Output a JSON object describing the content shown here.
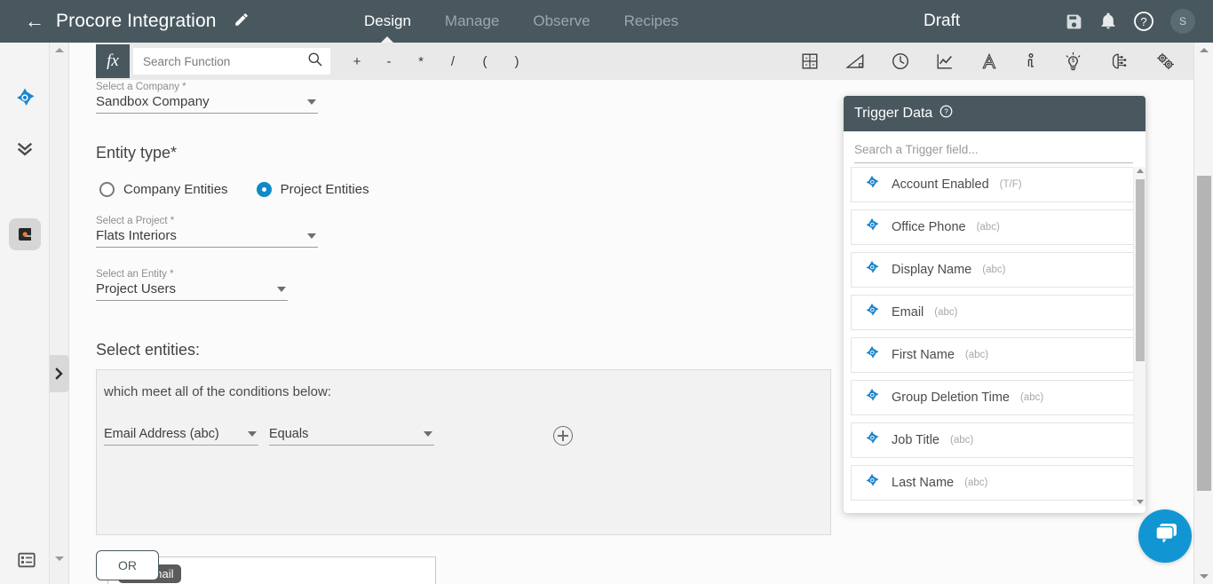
{
  "header": {
    "back_label": "back-arrow",
    "recipe_title": "Procore Integration",
    "edit_icon": "pencil-icon",
    "tabs": [
      {
        "label": "Design",
        "active": true
      },
      {
        "label": "Manage",
        "active": false
      },
      {
        "label": "Observe",
        "active": false
      },
      {
        "label": "Recipes",
        "active": false
      }
    ],
    "status": "Draft",
    "icons": [
      "save-icon",
      "notifications-bell-icon",
      "help-question-icon"
    ],
    "avatar_initial": "S"
  },
  "left_rail": {
    "items": [
      {
        "name": "azure-ad-trigger-icon"
      },
      {
        "name": "collapse-steps-icon"
      },
      {
        "name": "procore-step-icon"
      },
      {
        "name": "job-list-icon"
      }
    ],
    "expand_tab": "expand-panel-chevron-icon"
  },
  "formula_bar": {
    "fx_label": "fx",
    "search_placeholder": "Search Function",
    "search_value": "",
    "search_icon": "search-icon",
    "operators": [
      "+",
      "-",
      "*",
      "/",
      "(",
      ")"
    ],
    "tools": [
      "calculator-icon",
      "trigonometry-icon",
      "clock-icon",
      "chart-line-icon",
      "text-format-icon",
      "info-icon",
      "lightbulb-dollar-icon",
      "ai-brain-icon",
      "gears-icon"
    ]
  },
  "form": {
    "company": {
      "label": "Select a Company *",
      "value": "Sandbox Company"
    },
    "entity_type": {
      "title": "Entity type*",
      "options": [
        {
          "label": "Company Entities",
          "selected": false
        },
        {
          "label": "Project Entities",
          "selected": true
        }
      ]
    },
    "project": {
      "label": "Select a Project *",
      "value": "Flats Interiors"
    },
    "entity": {
      "label": "Select an Entity *",
      "value": "Project Users"
    },
    "select_entities_title": "Select entities:",
    "conditions": {
      "header": "which meet all of the conditions below:",
      "field": "Email Address (abc)",
      "operator": "Equals",
      "add_icon": "add-condition-icon",
      "value_pill": {
        "icon": "azure-ad-datapill-icon",
        "text": "Email"
      }
    },
    "or_button": "OR"
  },
  "trigger_panel": {
    "title": "Trigger Data",
    "help_icon": "help-question-icon",
    "search_placeholder": "Search a Trigger field...",
    "search_value": "",
    "fields": [
      {
        "name": "Account Enabled",
        "type": "(T/F)"
      },
      {
        "name": "Office Phone",
        "type": "(abc)"
      },
      {
        "name": "Display Name",
        "type": "(abc)"
      },
      {
        "name": "Email",
        "type": "(abc)"
      },
      {
        "name": "First Name",
        "type": "(abc)"
      },
      {
        "name": "Group Deletion Time",
        "type": "(abc)"
      },
      {
        "name": "Job Title",
        "type": "(abc)"
      },
      {
        "name": "Last Name",
        "type": "(abc)"
      }
    ]
  },
  "chat": {
    "icon": "chat-bubbles-icon"
  },
  "colors": {
    "header_bg": "#49585f",
    "accent_blue": "#0c8ac9",
    "datapill_blue": "#1b86cd",
    "chat_blue": "#1296d3",
    "procore_orange": "#f47b32",
    "canvas_bg": "#fbfbfb",
    "panel_bg": "#f2f2f2"
  }
}
